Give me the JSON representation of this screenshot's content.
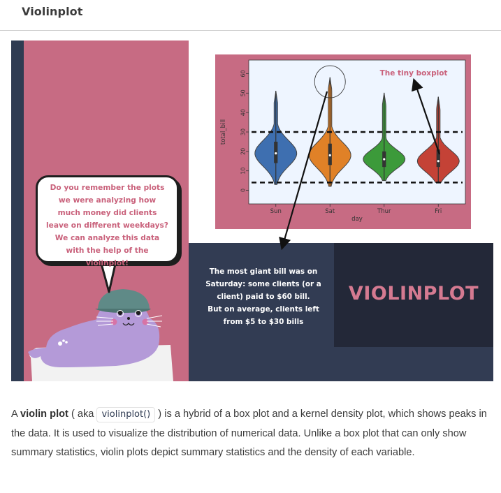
{
  "header": {
    "title": "Violinplot"
  },
  "bubble": {
    "lines": [
      "Do you remember the plots",
      "we were analyzing how",
      "much money did clients",
      "leave on different weekdays?",
      "We can analyze this data",
      "with the help of the",
      "violinplot!"
    ]
  },
  "caption": {
    "lines": [
      "The most giant bill was on",
      "Saturday: some clients (or a",
      "client) paid to $60 bill.",
      "But on average, clients left",
      "from $5 to $30 bills"
    ]
  },
  "banner_title": "VIOLINPLOT",
  "annotation": "The tiny boxplot",
  "chart_data": {
    "type": "violin",
    "xlabel": "day",
    "ylabel": "total_bill",
    "categories": [
      "Sun",
      "Sat",
      "Thur",
      "Fri"
    ],
    "yticks": [
      0,
      10,
      20,
      30,
      40,
      50,
      60
    ],
    "ylim": [
      -7,
      67
    ],
    "series": [
      {
        "category": "Sun",
        "min": 3,
        "q1": 14,
        "median": 19,
        "q3": 25,
        "max": 51,
        "color": "#3e6fb0"
      },
      {
        "category": "Sat",
        "min": 2,
        "q1": 13,
        "median": 18,
        "q3": 24,
        "max": 58,
        "color": "#e08127"
      },
      {
        "category": "Thur",
        "min": 5,
        "q1": 12,
        "median": 16,
        "q3": 20,
        "max": 50,
        "color": "#3c9a3a"
      },
      {
        "category": "Fri",
        "min": 4,
        "q1": 12,
        "median": 15,
        "q3": 21,
        "max": 48,
        "color": "#c44236"
      }
    ],
    "reference_lines": [
      30,
      4
    ],
    "grid": false,
    "colors": {
      "frame": "#c76b83",
      "plot_bg": "#eef5ff"
    }
  },
  "paragraph": {
    "p1": "A ",
    "term": "violin plot",
    "p2": " ( aka ",
    "code": "violinplot()",
    "p3": " ) is a hybrid of a box plot and a kernel density plot, which shows peaks in the data. It is used to visualize the distribution of numerical data. Unlike a box plot that can only show summary statistics, violin plots depict summary statistics and the density of each variable."
  }
}
